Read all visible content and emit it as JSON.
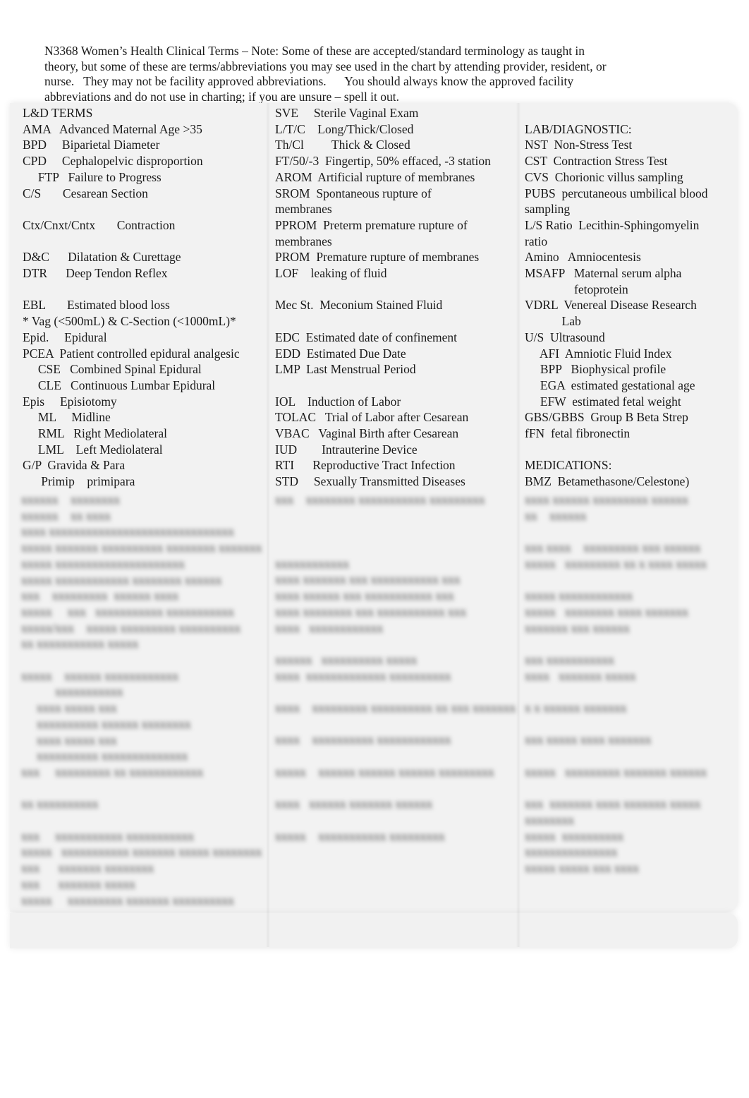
{
  "intro": {
    "lines": [
      "N3368 Women’s Health Clinical Terms – Note: Some of these are accepted/standard terminology as taught in",
      "theory, but some of these are terms/abbreviations you may see used in the chart by attending provider, resident, or",
      "nurse.   They may not be facility approved abbreviations.      You should always know the approved facility",
      "abbreviations and do not use in charting; if you are unsure – spell it out."
    ]
  },
  "columns": {
    "left": {
      "rows": [
        {
          "text": "L&D TERMS"
        },
        {
          "text": "AMA   Advanced Maternal Age >35"
        },
        {
          "text": "BPD     Biparietal Diameter"
        },
        {
          "text": "CPD     Cephalopelvic disproportion"
        },
        {
          "text": "     FTP   Failure to Progress"
        },
        {
          "text": "C/S       Cesarean Section"
        },
        {
          "text": ""
        },
        {
          "text": "Ctx/Cnxt/Cntx       Contraction"
        },
        {
          "text": ""
        },
        {
          "text": "D&C      Dilatation & Curettage"
        },
        {
          "text": "DTR      Deep Tendon Reflex"
        },
        {
          "text": ""
        },
        {
          "text": "EBL       Estimated blood loss"
        },
        {
          "text": "* Vag (<500mL) & C-Section (<1000mL)*"
        },
        {
          "text": "Epid.     Epidural"
        },
        {
          "text": "PCEA  Patient controlled epidural analgesic"
        },
        {
          "text": "     CSE   Combined Spinal Epidural"
        },
        {
          "text": "     CLE   Continuous Lumbar Epidural"
        },
        {
          "text": "Epis     Episiotomy"
        },
        {
          "text": "     ML     Midline"
        },
        {
          "text": "     RML   Right Mediolateral"
        },
        {
          "text": "     LML    Left Mediolateral"
        },
        {
          "text": "G/P  Gravida & Para"
        },
        {
          "text": "      Primip    primipara"
        }
      ]
    },
    "middle": {
      "rows": [
        {
          "text": "SVE     Sterile Vaginal Exam"
        },
        {
          "text": "L/T/C    Long/Thick/Closed"
        },
        {
          "text": "Th/Cl         Thick & Closed"
        },
        {
          "text": "FT/50/-3  Fingertip, 50% effaced, -3 station"
        },
        {
          "text": "AROM  Artificial rupture of membranes"
        },
        {
          "text": "SROM  Spontaneous rupture of"
        },
        {
          "text": "membranes"
        },
        {
          "text": "PPROM  Preterm premature rupture of"
        },
        {
          "text": "membranes"
        },
        {
          "text": "PROM  Premature rupture of membranes"
        },
        {
          "text": "LOF    leaking of fluid"
        },
        {
          "text": ""
        },
        {
          "text": "Mec St.  Meconium Stained Fluid"
        },
        {
          "text": ""
        },
        {
          "text": "EDC  Estimated date of confinement"
        },
        {
          "text": "EDD  Estimated Due Date"
        },
        {
          "text": "LMP  Last Menstrual Period"
        },
        {
          "text": ""
        },
        {
          "text": "IOL    Induction of Labor"
        },
        {
          "text": "TOLAC   Trial of Labor after Cesarean"
        },
        {
          "text": "VBAC   Vaginal Birth after Cesarean"
        },
        {
          "text": "IUD        Intrauterine Device"
        },
        {
          "text": "RTI      Reproductive Tract Infection"
        },
        {
          "text": "STD     Sexually Transmitted Diseases"
        }
      ]
    },
    "right": {
      "rows": [
        {
          "text": ""
        },
        {
          "text": "LAB/DIAGNOSTIC:"
        },
        {
          "text": "NST  Non-Stress Test"
        },
        {
          "text": "CST  Contraction Stress Test"
        },
        {
          "text": "CVS  Chorionic villus sampling"
        },
        {
          "text": "PUBS  percutaneous umbilical blood"
        },
        {
          "text": "sampling"
        },
        {
          "text": "L/S Ratio  Lecithin-Sphingomyelin"
        },
        {
          "text": "ratio"
        },
        {
          "text": "Amino   Amniocentesis"
        },
        {
          "text": "MSAFP   Maternal serum alpha"
        },
        {
          "text": "                fetoprotein"
        },
        {
          "text": "VDRL  Venereal Disease Research"
        },
        {
          "text": "            Lab"
        },
        {
          "text": "U/S  Ultrasound"
        },
        {
          "text": "     AFI  Amniotic Fluid Index"
        },
        {
          "text": "     BPP   Biophysical profile"
        },
        {
          "text": "     EGA  estimated gestational age"
        },
        {
          "text": "     EFW  estimated fetal weight"
        },
        {
          "text": "GBS/GBBS  Group B Beta Strep"
        },
        {
          "text": "fFN  fetal fibronectin"
        },
        {
          "text": ""
        },
        {
          "text": "MEDICATIONS:"
        },
        {
          "text": "BMZ  Betamethasone/Celestone)"
        }
      ]
    }
  },
  "obscured_content": {
    "note": "Remaining content is blurred/unreadable in the screenshot",
    "left": [
      "xxxxxx    xxxxxxxx",
      "xxxxxx    xx xxxx",
      "xxxx xxxxxxxxxxxxxxxxxxxxxxxxxxxxxx",
      "xxxxx xxxxxxx xxxxxxxxxx xxxxxxxx xxxxxxx",
      "xxxxx xxxxxxxxxxxxxxxxxxxxx",
      "xxxxx xxxxxxxxxxxx xxxxxxxx xxxxxx",
      "xxx    xxxxxxxxx  xxxxxx xxxx",
      "xxxxx     xxx   xxxxxxxxxxx xxxxxxxxxxx",
      "xxxxx/xxx    xxxxx xxxxxxxxx xxxxxxxxxx",
      "xx xxxxxxxxxxx xxxxx",
      "",
      "xxxxx    xxxxxx xxxxxxxxxxxx",
      "           xxxxxxxxxxx",
      "     xxxx xxxxx xxx",
      "     xxxxxxxxxx xxxxxx xxxxxxxx",
      "     xxxx xxxxx xxx",
      "     xxxxxxxxxx xxxxxxxxxxxxxx",
      "xxx     xxxxxxxxx xx xxxxxxxxxxxx",
      "",
      "xx xxxxxxxxxx",
      "",
      "xxx     xxxxxxxxxxx xxxxxxxxxxx",
      "xxxxx   xxxxxxxxxxx xxxxxxx xxxxx xxxxxxxx",
      "xxx      xxxxxxx xxxxxxxx",
      "xxx      xxxxxxx xxxxx",
      "xxxxx     xxxxxxxxx xxxxxxx xxxxxxxxxx"
    ],
    "middle": [
      "xxx    xxxxxxxx xxxxxxxxxxx xxxxxxxxx",
      "",
      "",
      "",
      "xxxxxxxxxxxx",
      "xxxx xxxxxxx xxx xxxxxxxxxxx xxx",
      "xxxx xxxxxx xxx xxxxxxxxxxx xxx",
      "xxxx xxxxxxxx xxx xxxxxxxxxxx xxx",
      "xxxx   xxxxxxxxxxxx",
      "",
      "xxxxxx   xxxxxxxxxx xxxxx",
      "xxxx  xxxxxxxxxxxxx xxxxxxxxxx",
      "",
      "xxxx    xxxxxxxxx xxxxxxxxxx xx xxx xxxxxxx",
      "",
      "xxxx    xxxxxxxxxx xxxxxxxxxxxx",
      "",
      "xxxxx    xxxxxx xxxxxx xxxxxx xxxxxxxxx",
      "",
      "xxxx   xxxxxx xxxxxxx xxxxxx",
      "",
      "xxxxx    xxxxxxxxxxx xxxxxxxxx"
    ],
    "right": [
      "xxxx xxxxxx xxxxxxxxx xxxxxx",
      "xx    xxxxxx",
      "",
      "xxx xxxx    xxxxxxxxx xxx xxxxxx",
      "xxxxx   xxxxxxxxx xx x xxxx xxxxx",
      "",
      "xxxxx xxxxxxxxxxxx",
      "xxxxx   xxxxxxxx xxxx xxxxxxx",
      "xxxxxxx xxx xxxxxx",
      "",
      "xxx xxxxxxxxxxx",
      "xxxx   xxxxxxx xxxxx",
      "",
      "x x xxxxxx xxxxxxx",
      "",
      "xxx xxxxx xxxx xxxxxxx",
      "",
      "xxxxx   xxxxxxxxx xxxxxxx xxxxxx",
      "",
      "xxx  xxxxxxx xxxx xxxxxxx xxxxx",
      "xxxxxxxx",
      "xxxxx  xxxxxxxxxx",
      "xxxxxxxxxxxxxxx",
      "xxxxx xxxxx xxx xxxx"
    ]
  }
}
